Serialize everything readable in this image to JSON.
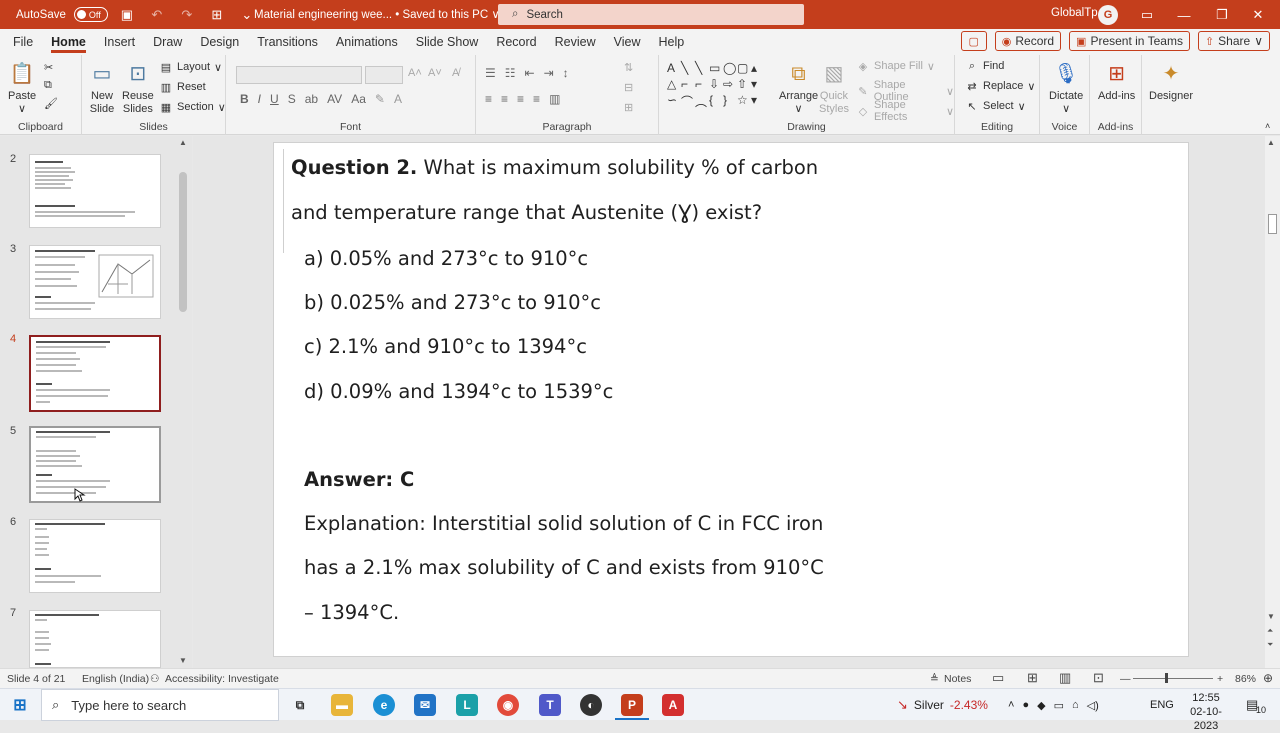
{
  "titlebar": {
    "autosave_label": "AutoSave",
    "autosave_state": "Off",
    "document_title": "Material engineering wee...  •  Saved to this PC ∨",
    "search_placeholder": "Search",
    "account_name": "GlobalTp",
    "avatar_initial": "G"
  },
  "ribbon_tabs": [
    "File",
    "Home",
    "Insert",
    "Draw",
    "Design",
    "Transitions",
    "Animations",
    "Slide Show",
    "Record",
    "Review",
    "View",
    "Help"
  ],
  "ribbon_right": {
    "record_label": "Record",
    "present_label": "Present in Teams",
    "share_label": "Share"
  },
  "ribbon": {
    "clipboard": {
      "paste": "Paste",
      "label": "Clipboard"
    },
    "slides": {
      "new_slide": "New\nSlide",
      "reuse": "Reuse\nSlides",
      "layout": "Layout",
      "reset": "Reset",
      "section": "Section",
      "label": "Slides"
    },
    "font": {
      "label": "Font"
    },
    "paragraph": {
      "label": "Paragraph"
    },
    "drawing": {
      "arrange": "Arrange",
      "quick_styles": "Quick\nStyles",
      "shape_fill": "Shape Fill",
      "shape_outline": "Shape Outline",
      "shape_effects": "Shape Effects",
      "label": "Drawing"
    },
    "editing": {
      "find": "Find",
      "replace": "Replace",
      "select": "Select",
      "label": "Editing"
    },
    "voice": {
      "dictate": "Dictate",
      "label": "Voice"
    },
    "addins": {
      "addins": "Add-ins",
      "label": "Add-ins"
    },
    "designer": {
      "designer": "Designer"
    }
  },
  "thumbnails": [
    {
      "num": "2"
    },
    {
      "num": "3"
    },
    {
      "num": "4"
    },
    {
      "num": "5"
    },
    {
      "num": "6"
    },
    {
      "num": "7"
    }
  ],
  "slide": {
    "question_bold": "Question 2.",
    "question_rest": " What is maximum solubility % of carbon",
    "question_line2": "and temperature range that Austenite (Ɣ) exist?",
    "option_a": "a) 0.05% and 273°c to 910°c",
    "option_b": "b) 0.025% and 273°c to 910°c",
    "option_c": "c) 2.1% and 910°c to 1394°c",
    "option_d": "d) 0.09% and 1394°c to 1539°c",
    "answer": "Answer: C",
    "explanation_1": "Explanation: Interstitial solid solution of C in FCC iron",
    "explanation_2": "has a 2.1% max solubility of C and exists from 910°C",
    "explanation_3": "– 1394°C."
  },
  "statusbar": {
    "slide_info": "Slide 4 of 21",
    "language": "English (India)",
    "accessibility": "Accessibility: Investigate",
    "notes": "Notes",
    "zoom": "86%"
  },
  "taskbar": {
    "search_placeholder": "Type here to search",
    "stock_name": "Silver",
    "stock_change": "-2.43%",
    "lang": "ENG",
    "time": "12:55",
    "date": "02-10-2023",
    "notif_count": "10"
  }
}
